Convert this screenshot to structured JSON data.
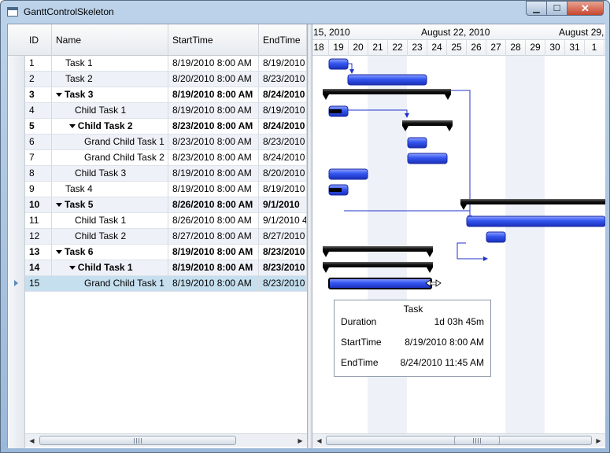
{
  "window": {
    "title": "GanttControlSkeleton",
    "close_label": "✕",
    "min_label": "▁",
    "max_label": "☐"
  },
  "grid": {
    "columns": [
      "ID",
      "Name",
      "StartTime",
      "EndTime"
    ],
    "rows": [
      {
        "id": "1",
        "name": "Task 1",
        "start": "8/19/2010 8:00 AM",
        "end": "8/19/2010",
        "level": 1,
        "bold": false,
        "expander": false
      },
      {
        "id": "2",
        "name": "Task 2",
        "start": "8/20/2010 8:00 AM",
        "end": "8/23/2010",
        "level": 1,
        "bold": false,
        "expander": false
      },
      {
        "id": "3",
        "name": "Task 3",
        "start": "8/19/2010 8:00 AM",
        "end": "8/24/2010",
        "level": 0,
        "bold": true,
        "expander": true
      },
      {
        "id": "4",
        "name": "Child Task 1",
        "start": "8/19/2010 8:00 AM",
        "end": "8/19/2010",
        "level": 2,
        "bold": false,
        "expander": false
      },
      {
        "id": "5",
        "name": "Child Task 2",
        "start": "8/23/2010 8:00 AM",
        "end": "8/24/2010",
        "level": 1.4,
        "bold": true,
        "expander": true
      },
      {
        "id": "6",
        "name": "Grand Child Task 1",
        "start": "8/23/2010 8:00 AM",
        "end": "8/23/2010",
        "level": 3,
        "bold": false,
        "expander": false
      },
      {
        "id": "7",
        "name": "Grand Child Task 2",
        "start": "8/23/2010 8:00 AM",
        "end": "8/24/2010",
        "level": 3,
        "bold": false,
        "expander": false
      },
      {
        "id": "8",
        "name": "Child Task 3",
        "start": "8/19/2010 8:00 AM",
        "end": "8/20/2010",
        "level": 2,
        "bold": false,
        "expander": false
      },
      {
        "id": "9",
        "name": "Task 4",
        "start": "8/19/2010 8:00 AM",
        "end": "8/19/2010",
        "level": 1,
        "bold": false,
        "expander": false
      },
      {
        "id": "10",
        "name": "Task 5",
        "start": "8/26/2010 8:00 AM",
        "end": "9/1/2010",
        "level": 0,
        "bold": true,
        "expander": true
      },
      {
        "id": "11",
        "name": "Child Task 1",
        "start": "8/26/2010 8:00 AM",
        "end": "9/1/2010 4",
        "level": 2,
        "bold": false,
        "expander": false
      },
      {
        "id": "12",
        "name": "Child Task 2",
        "start": "8/27/2010 8:00 AM",
        "end": "8/27/2010",
        "level": 2,
        "bold": false,
        "expander": false
      },
      {
        "id": "13",
        "name": "Task 6",
        "start": "8/19/2010 8:00 AM",
        "end": "8/23/2010",
        "level": 0,
        "bold": true,
        "expander": true
      },
      {
        "id": "14",
        "name": "Child Task 1",
        "start": "8/19/2010 8:00 AM",
        "end": "8/23/2010",
        "level": 1.4,
        "bold": true,
        "expander": true
      },
      {
        "id": "15",
        "name": "Grand Child Task 1",
        "start": "8/19/2010 8:00 AM",
        "end": "8/23/2010",
        "level": 3,
        "bold": false,
        "expander": false,
        "selected": true
      }
    ]
  },
  "gantt": {
    "major_labels": [
      "15, 2010",
      "August 22, 2010",
      "August 29,"
    ],
    "days": [
      "18",
      "19",
      "20",
      "21",
      "22",
      "23",
      "24",
      "25",
      "26",
      "27",
      "28",
      "29",
      "30",
      "31",
      "1"
    ],
    "tooltip": {
      "title": "Task",
      "rows": [
        {
          "label": "Duration",
          "value": "1d 03h 45m"
        },
        {
          "label": "StartTime",
          "value": "8/19/2010 8:00 AM"
        },
        {
          "label": "EndTime",
          "value": "8/24/2010 11:45 AM"
        }
      ]
    }
  },
  "colors": {
    "bar": "#2b4bd8",
    "summary": "#111111",
    "selection": "#c6dfef",
    "alt_row": "#eef2f8"
  }
}
